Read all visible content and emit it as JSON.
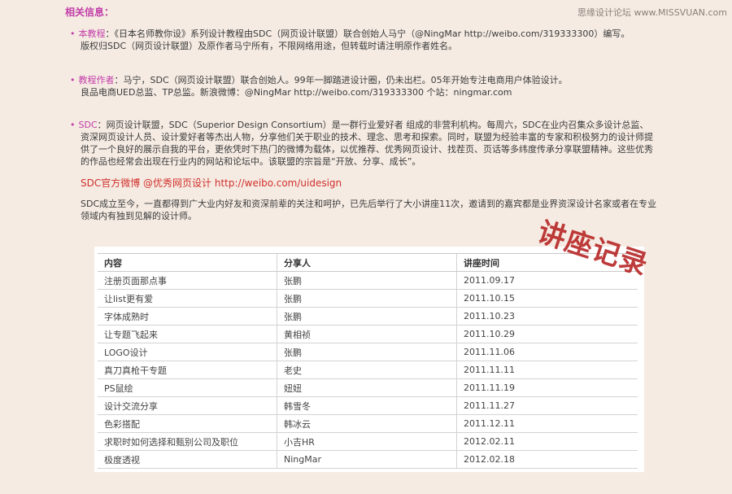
{
  "watermark": "思缘设计论坛 www.MISSVUAN.com",
  "section_title": "相关信息：",
  "notes": [
    {
      "label": "本教程",
      "line1": "：《日本名师教你设》系列设计教程由SDC（网页设计联盟）联合创始人马宁（@NingMar  http://weibo.com/319333300）编写。",
      "line2": "版权归SDC（网页设计联盟）及原作者马宁所有，不限网络用途，但转载时请注明原作者姓名。"
    },
    {
      "label": "教程作者",
      "line1": "：马宁，SDC（网页设计联盟）联合创始人。99年一脚踏进设计圈，仍未出栏。05年开始专注电商用户体验设计。",
      "line2": "良品电商UED总监、TP总监。新浪微博：@NingMar  http://weibo.com/319333300        个站：ningmar.com"
    },
    {
      "label": "SDC",
      "line1": "：网页设计联盟，SDC（Superior Design Consortium）是一群行业爱好者 组成的非营利机构。每周六，SDC在业内召集众多设计总监、",
      "line2": "资深网页设计人员、设计爱好者等杰出人物，分享他们关于职业的技术、理念、思考和探索。同时，联盟为经验丰富的专家和积极努力的设计师提",
      "line3": "供了一个良好的展示自我的平台，更依凭时下热门的微博为载体，以优推荐、优秀网页设计、找茬页、页话等多纬度传承分享联盟精神。这些优秀",
      "line4": "的作品也经常会出现在行业内的网站和论坛中。该联盟的宗旨是“开放、分享、成长”。"
    }
  ],
  "weibo_line": "SDC官方微博 @优秀网页设计 http://weibo.com/uidesign",
  "summary": {
    "line1": "SDC成立至今，一直都得到广大业内好友和资深前辈的关注和呵护，已先后举行了大小讲座11次，邀请到的嘉宾都是业界资深设计名家或者在专业",
    "line2": "领域内有独到见解的设计师。"
  },
  "table": {
    "headers": [
      "内容",
      "分享人",
      "讲座时间"
    ],
    "rows": [
      [
        "注册页面那点事",
        "张鹏",
        "2011.09.17"
      ],
      [
        "让list更有爱",
        "张鹏",
        "2011.10.15"
      ],
      [
        "字体成熟时",
        "张鹏",
        "2011.10.23"
      ],
      [
        "让专题飞起来",
        "黄相祯",
        "2011.10.29"
      ],
      [
        "LOGO设计",
        "张鹏",
        "2011.11.06"
      ],
      [
        "真刀真枪干专题",
        "老史",
        "2011.11.11"
      ],
      [
        "PS鼠绘",
        "妞妞",
        "2011.11.19"
      ],
      [
        "设计交流分享",
        "韩雪冬",
        "2011.11.27"
      ],
      [
        "色彩搭配",
        "韩冰云",
        "2011.12.11"
      ],
      [
        "求职时如何选择和甄别公司及职位",
        "小吉HR",
        "2012.02.11"
      ],
      [
        "极度透视",
        "NingMar",
        "2012.02.18"
      ]
    ]
  },
  "stamp": "讲座记录",
  "colors": {
    "accent": "#c23da8",
    "link_red": "#d1302b",
    "background": "#f5ebe3",
    "stamp": "#b31a1a"
  }
}
